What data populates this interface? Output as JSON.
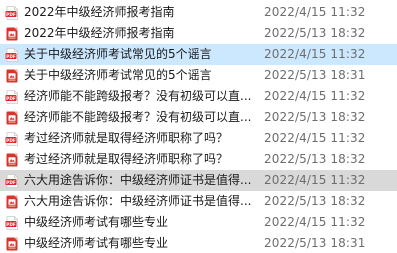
{
  "files": [
    {
      "name": "2022年中级经济师报考指南",
      "modified": "2022/4/15 11:32",
      "icon": "pdf-file-icon",
      "state": "normal"
    },
    {
      "name": "2022年中级经济师报考指南",
      "modified": "2022/5/13 18:32",
      "icon": "wps-pdf-file-icon",
      "state": "normal"
    },
    {
      "name": "关于中级经济师考试常见的5个谣言",
      "modified": "2022/4/15 11:32",
      "icon": "pdf-file-icon",
      "state": "selected"
    },
    {
      "name": "关于中级经济师考试常见的5个谣言",
      "modified": "2022/5/13 18:31",
      "icon": "wps-pdf-file-icon",
      "state": "normal"
    },
    {
      "name": "经济师能不能跨级报考？没有初级可以直...",
      "modified": "2022/4/15 11:32",
      "icon": "pdf-file-icon",
      "state": "normal"
    },
    {
      "name": "经济师能不能跨级报考？没有初级可以直...",
      "modified": "2022/5/13 18:32",
      "icon": "wps-pdf-file-icon",
      "state": "normal"
    },
    {
      "name": "考过经济师就是取得经济师职称了吗？",
      "modified": "2022/4/15 11:32",
      "icon": "pdf-file-icon",
      "state": "normal"
    },
    {
      "name": "考过经济师就是取得经济师职称了吗？",
      "modified": "2022/5/13 18:32",
      "icon": "wps-pdf-file-icon",
      "state": "normal"
    },
    {
      "name": "六大用途告诉你：中级经济师证书是值得...",
      "modified": "2022/4/15 11:32",
      "icon": "pdf-file-icon",
      "state": "hover"
    },
    {
      "name": "六大用途告诉你：中级经济师证书是值得...",
      "modified": "2022/5/13 18:32",
      "icon": "wps-pdf-file-icon",
      "state": "normal"
    },
    {
      "name": "中级经济师考试有哪些专业",
      "modified": "2022/4/15 11:32",
      "icon": "pdf-file-icon",
      "state": "normal"
    },
    {
      "name": "中级经济师考试有哪些专业",
      "modified": "2022/5/13 18:31",
      "icon": "wps-pdf-file-icon",
      "state": "normal"
    }
  ],
  "colors": {
    "pdf_icon": "#e2252b",
    "wps_pdf_icon": "#d9342b",
    "selected_bg": "#cce8ff",
    "hover_bg": "#d9d9d9",
    "date_text": "#6d6d6d"
  }
}
